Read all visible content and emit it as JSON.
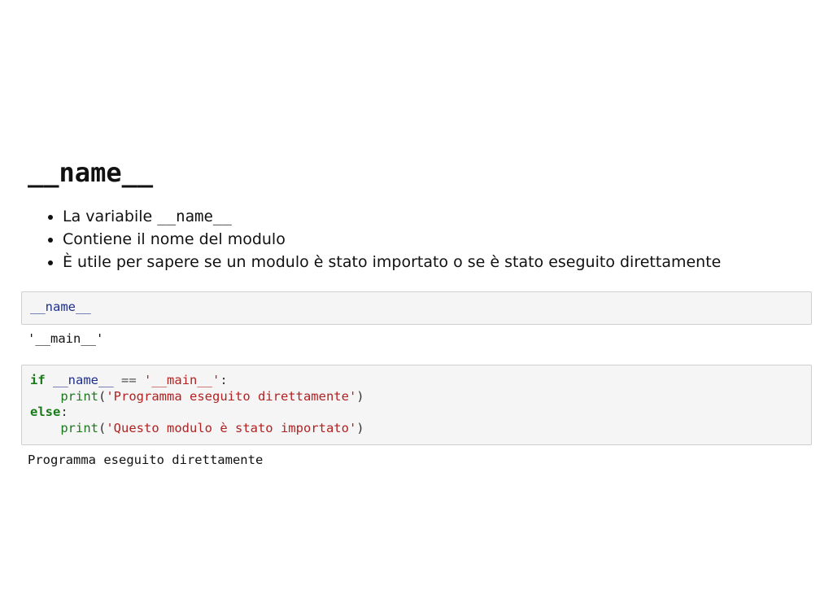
{
  "slide": {
    "title": "__name__",
    "bullets": [
      {
        "prefix": "La variabile ",
        "code": "__name__"
      },
      {
        "text": "Contiene il nome del modulo"
      },
      {
        "text": "È utile per sapere se un modulo è stato importato o se è stato eseguito direttamente"
      }
    ]
  },
  "cells": {
    "cell1": {
      "code": "__name__"
    },
    "output1": "'__main__'",
    "cell2": {
      "line1": {
        "kw": "if",
        "name": "__name__",
        "op": "==",
        "str": "'__main__'",
        "colon": ":"
      },
      "line2": {
        "func": "print",
        "open": "(",
        "str": "'Programma eseguito direttamente'",
        "close": ")"
      },
      "line3": {
        "kw": "else",
        "colon": ":"
      },
      "line4": {
        "func": "print",
        "open": "(",
        "str": "'Questo modulo è stato importato'",
        "close": ")"
      }
    },
    "output2": "Programma eseguito direttamente"
  },
  "colors": {
    "keyword": "#1a7a1a",
    "name": "#1f2f8f",
    "string": "#b22222",
    "cell_background": "#f5f5f5"
  }
}
